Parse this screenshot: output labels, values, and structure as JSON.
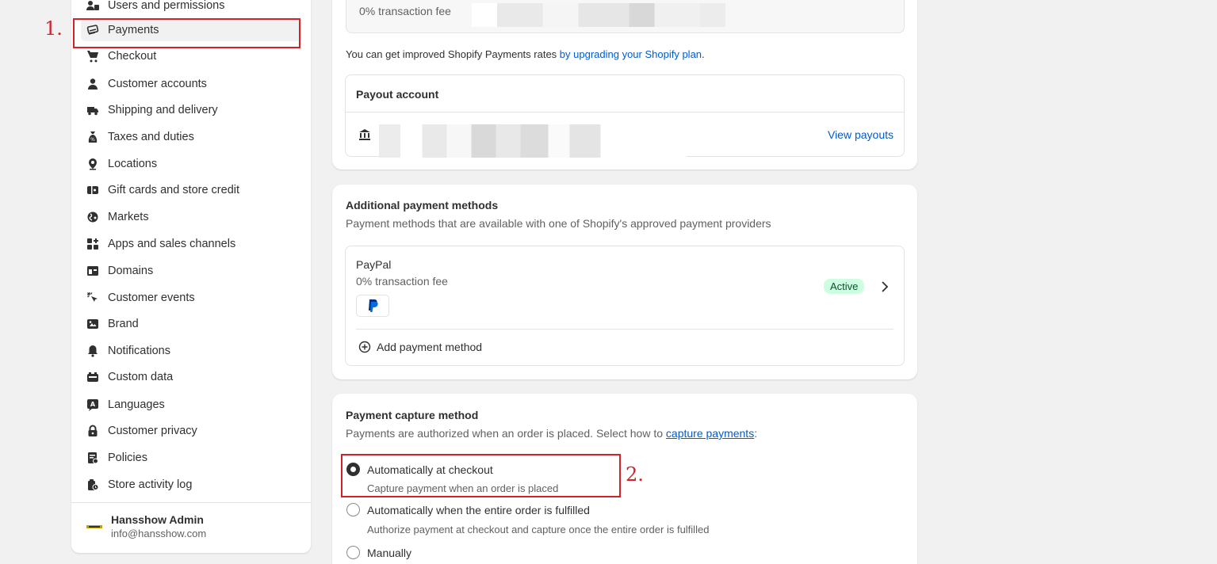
{
  "sidebar": {
    "items": [
      {
        "label": "Users and permissions",
        "icon": "users-icon"
      },
      {
        "label": "Payments",
        "icon": "payments-icon",
        "active": true
      },
      {
        "label": "Checkout",
        "icon": "cart-icon"
      },
      {
        "label": "Customer accounts",
        "icon": "person-icon"
      },
      {
        "label": "Shipping and delivery",
        "icon": "truck-icon"
      },
      {
        "label": "Taxes and duties",
        "icon": "tax-bag-icon"
      },
      {
        "label": "Locations",
        "icon": "location-pin-icon"
      },
      {
        "label": "Gift cards and store credit",
        "icon": "gift-card-icon"
      },
      {
        "label": "Markets",
        "icon": "globe-icon"
      },
      {
        "label": "Apps and sales channels",
        "icon": "apps-icon"
      },
      {
        "label": "Domains",
        "icon": "domains-icon"
      },
      {
        "label": "Customer events",
        "icon": "cursor-click-icon"
      },
      {
        "label": "Brand",
        "icon": "brand-icon"
      },
      {
        "label": "Notifications",
        "icon": "bell-icon"
      },
      {
        "label": "Custom data",
        "icon": "custom-data-icon"
      },
      {
        "label": "Languages",
        "icon": "language-icon"
      },
      {
        "label": "Customer privacy",
        "icon": "lock-icon"
      },
      {
        "label": "Policies",
        "icon": "policies-icon"
      },
      {
        "label": "Store activity log",
        "icon": "activity-log-icon"
      }
    ],
    "user": {
      "name": "Hansshow Admin",
      "email": "info@hansshow.com"
    }
  },
  "shopify_payments": {
    "fee_text": "0% transaction fee",
    "upgrade_text": "You can get improved Shopify Payments rates ",
    "upgrade_link": "by upgrading your Shopify plan",
    "upgrade_suffix": "."
  },
  "payout": {
    "title": "Payout account",
    "view_link": "View payouts"
  },
  "additional": {
    "title": "Additional payment methods",
    "subtitle": "Payment methods that are available with one of Shopify's approved payment providers",
    "provider_name": "PayPal",
    "provider_fee": "0% transaction fee",
    "status": "Active",
    "add_label": "Add payment method"
  },
  "capture": {
    "title": "Payment capture method",
    "subtitle_prefix": "Payments are authorized when an order is placed. Select how to ",
    "subtitle_link": "capture payments",
    "subtitle_suffix": ":",
    "options": [
      {
        "label": "Automatically at checkout",
        "desc": "Capture payment when an order is placed",
        "checked": true
      },
      {
        "label": "Automatically when the entire order is fulfilled",
        "desc": "Authorize payment at checkout and capture once the entire order is fulfilled",
        "checked": false
      },
      {
        "label": "Manually",
        "desc": "",
        "checked": false
      }
    ]
  },
  "annotations": {
    "first": "1.",
    "second": "2."
  },
  "colors": {
    "accent_link": "#005bd3",
    "annotation_red": "#d3222a",
    "active_badge": "#cdfee1"
  }
}
